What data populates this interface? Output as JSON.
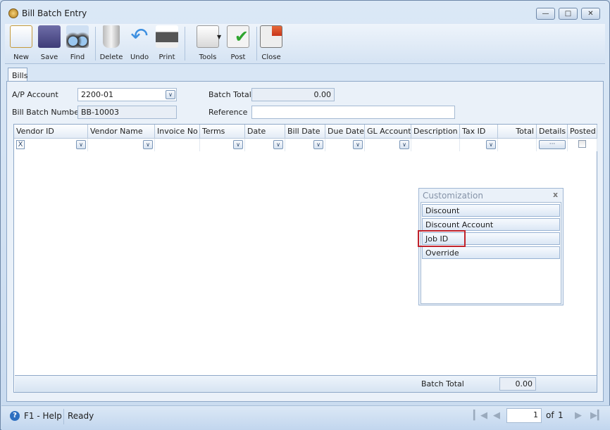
{
  "window": {
    "title": "Bill Batch Entry",
    "controls": [
      "minimize",
      "maximize",
      "close"
    ]
  },
  "toolbar": {
    "items": [
      {
        "label": "New",
        "icon": "new-document-icon"
      },
      {
        "label": "Save",
        "icon": "floppy-disk-icon"
      },
      {
        "label": "Find",
        "icon": "binoculars-icon"
      },
      {
        "label": "Delete",
        "icon": "trash-can-icon"
      },
      {
        "label": "Undo",
        "icon": "undo-arrow-icon"
      },
      {
        "label": "Print",
        "icon": "printer-icon"
      },
      {
        "label": "Tools",
        "icon": "tools-icon"
      },
      {
        "label": "Post",
        "icon": "post-checkmark-icon"
      },
      {
        "label": "Close",
        "icon": "close-window-icon"
      }
    ]
  },
  "tabs": [
    {
      "label": "Bills",
      "active": true
    }
  ],
  "form": {
    "ap_account_label": "A/P Account",
    "ap_account_value": "2200-01",
    "bill_batch_number_label": "Bill Batch Number",
    "bill_batch_number_value": "BB-10003",
    "batch_total_label": "Batch Total",
    "batch_total_value": "0.00",
    "reference_label": "Reference",
    "reference_value": ""
  },
  "grid": {
    "columns": [
      "Vendor ID",
      "Vendor Name",
      "Invoice No",
      "Terms",
      "Date",
      "Bill Date",
      "Due Date",
      "GL Account",
      "Description",
      "Tax ID",
      "Total",
      "Details",
      "Posted"
    ],
    "new_row": {
      "vendor_id": "X",
      "details_button": "···",
      "posted": false
    },
    "footer": {
      "batch_total_label": "Batch Total",
      "batch_total_value": "0.00"
    }
  },
  "customization": {
    "title": "Customization",
    "close": "x",
    "items": [
      "Discount",
      "Discount Account",
      "Job ID",
      "Override"
    ],
    "highlighted": "Job ID",
    "highlight_color": "#c0222b"
  },
  "status": {
    "help": "F1 - Help",
    "state": "Ready",
    "page": "1",
    "of_label": "of",
    "total_pages": "1"
  }
}
